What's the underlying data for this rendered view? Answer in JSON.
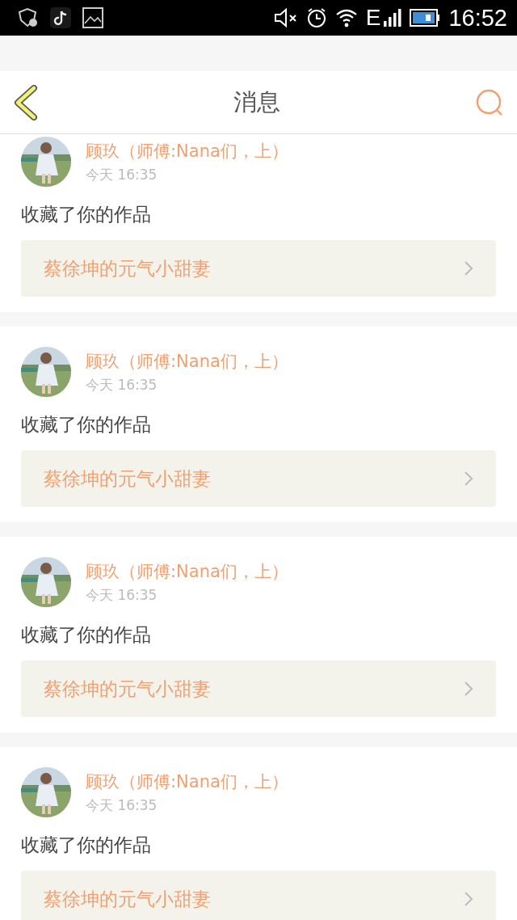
{
  "status_bar": {
    "network": "E",
    "time": "16:52"
  },
  "header": {
    "title": "消息"
  },
  "messages": [
    {
      "name": "顾玖（师傅:Nana们，上）",
      "time": "今天 16:35",
      "action": "收藏了你的作品",
      "work": "蔡徐坤的元气小甜妻"
    },
    {
      "name": "顾玖（师傅:Nana们，上）",
      "time": "今天 16:35",
      "action": "收藏了你的作品",
      "work": "蔡徐坤的元气小甜妻"
    },
    {
      "name": "顾玖（师傅:Nana们，上）",
      "time": "今天 16:35",
      "action": "收藏了你的作品",
      "work": "蔡徐坤的元气小甜妻"
    },
    {
      "name": "顾玖（师傅:Nana们，上）",
      "time": "今天 16:35",
      "action": "收藏了你的作品",
      "work": "蔡徐坤的元气小甜妻"
    }
  ]
}
